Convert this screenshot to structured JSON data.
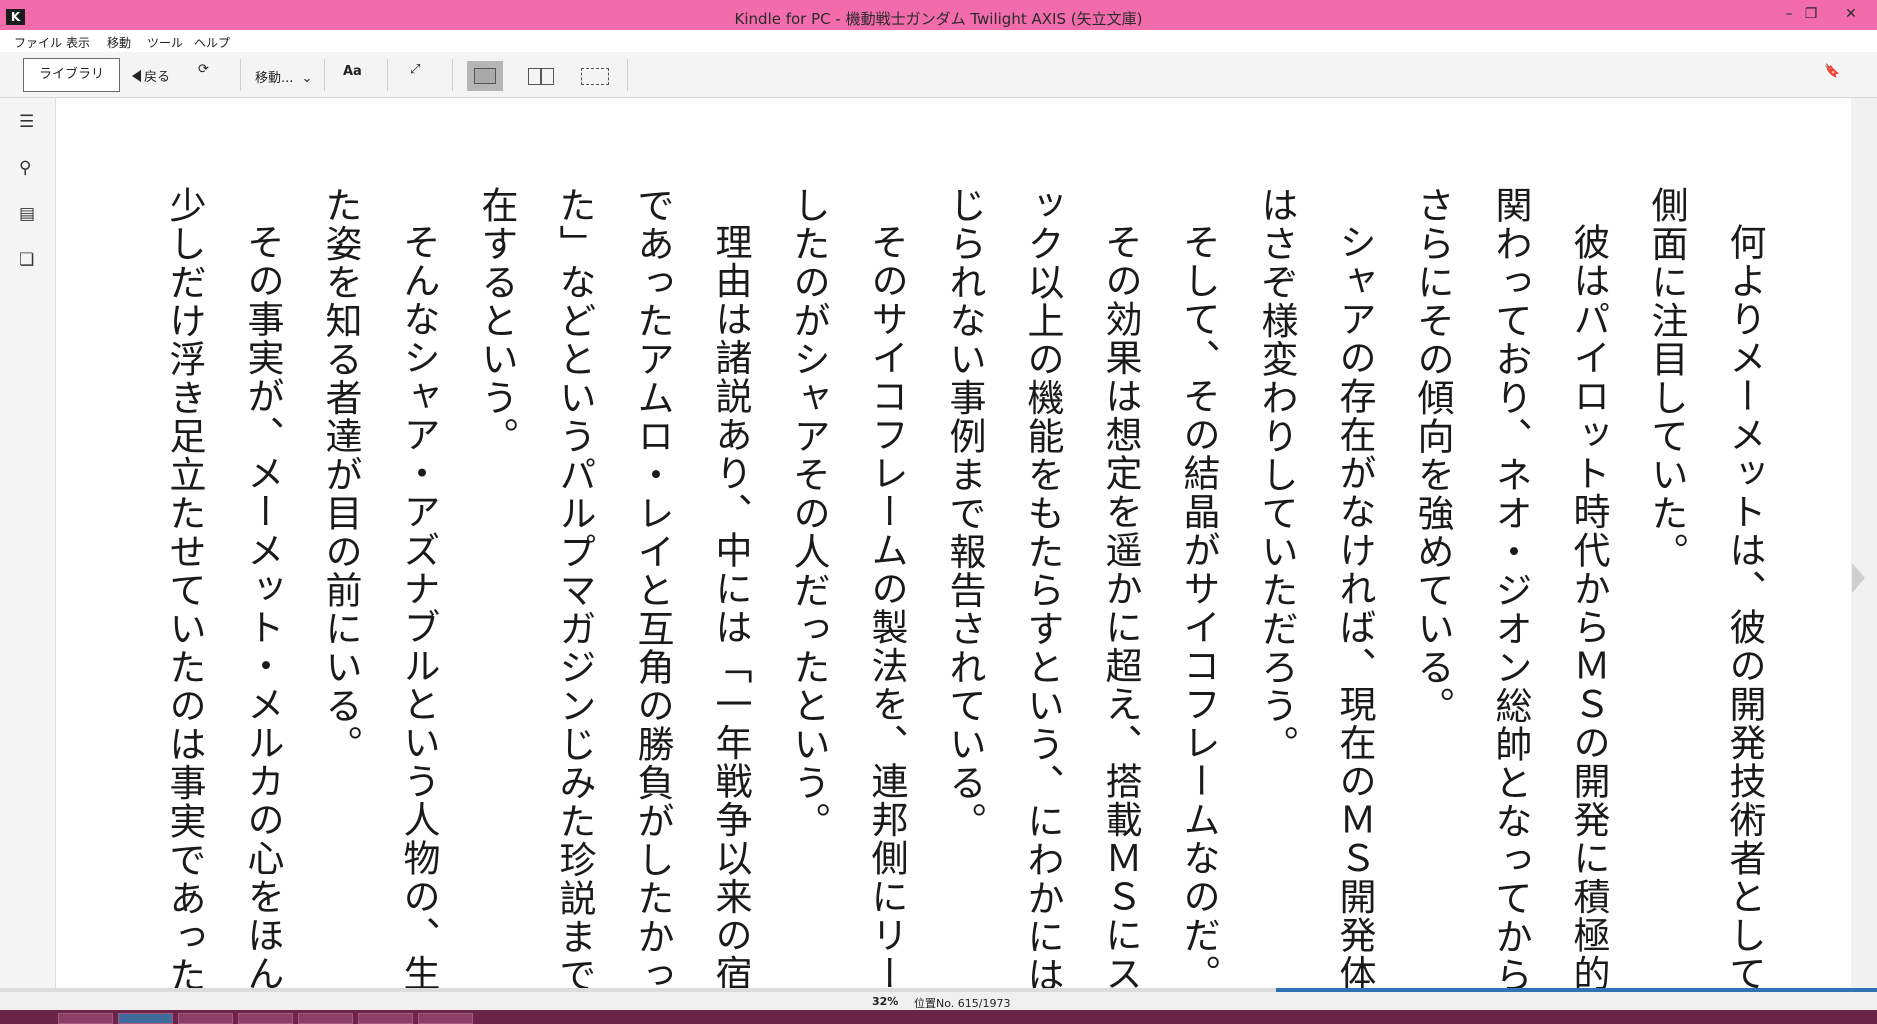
{
  "window": {
    "title": "Kindle for PC - 機動戦士ガンダム Twilight AXIS (矢立文庫)",
    "app_icon": "K",
    "controls": {
      "minimize": "–",
      "restore": "❐",
      "close": "✕"
    },
    "colors": {
      "titlebar": "#f26cab",
      "taskbar": "#6a2448",
      "progress": "#2e74b5"
    }
  },
  "menu": [
    "ファイル",
    "表示",
    "移動",
    "ツール",
    "ヘルプ"
  ],
  "toolbar": {
    "library_label": "ライブラリ",
    "back_label": "戻る",
    "sync_icon": "⟳",
    "goto_label": "移動...",
    "goto_chevron": "⌄",
    "font_label": "Aa",
    "fullscreen_icon": "⤢",
    "bookmark_icon": "🔖"
  },
  "sidebar": {
    "icons": [
      "toc-icon",
      "search-icon",
      "notes-icon",
      "flashcards-icon"
    ],
    "glyphs": {
      "toc": "☰",
      "search": "⚲",
      "notes": "▤",
      "flashcards": "❏"
    }
  },
  "book": {
    "paragraphs": [
      "何よりメーメットは、彼の開発技術者としての側面に注目していた。",
      "彼はパイロット時代からＭＳの開発に積極的に関わっており、ネオ・ジオン総帥となってからはさらにその傾向を強めている。",
      "シャアの存在がなければ、現在のＭＳ開発体系はさぞ様変わりしていただろう。",
      "そして、その結晶がサイコフレームなのだ。",
      "その効果は想定を遥かに超え、搭載ＭＳにスペック以上の機能をもたらすという、にわかには信じられない事例まで報告されている。",
      "そのサイコフレームの製法を、連邦側にリークしたのがシャアその人だったという。",
      "理由は諸説あり、中には「一年戦争以来の宿敵であったアムロ・レイと互角の勝負がしたかった」などというパルプマガジンじみた珍説まで存在するという。",
      "そんなシャア・アズナブルという人物の、生きた姿を知る者達が目の前にいる。",
      "その事実が、メーメット・メルカの心をほんの少しだけ浮き足立たせていたのは事実であった。"
    ]
  },
  "status": {
    "percent": "32%",
    "location": "位置No. 615/1973",
    "progress_fraction": 0.32
  }
}
